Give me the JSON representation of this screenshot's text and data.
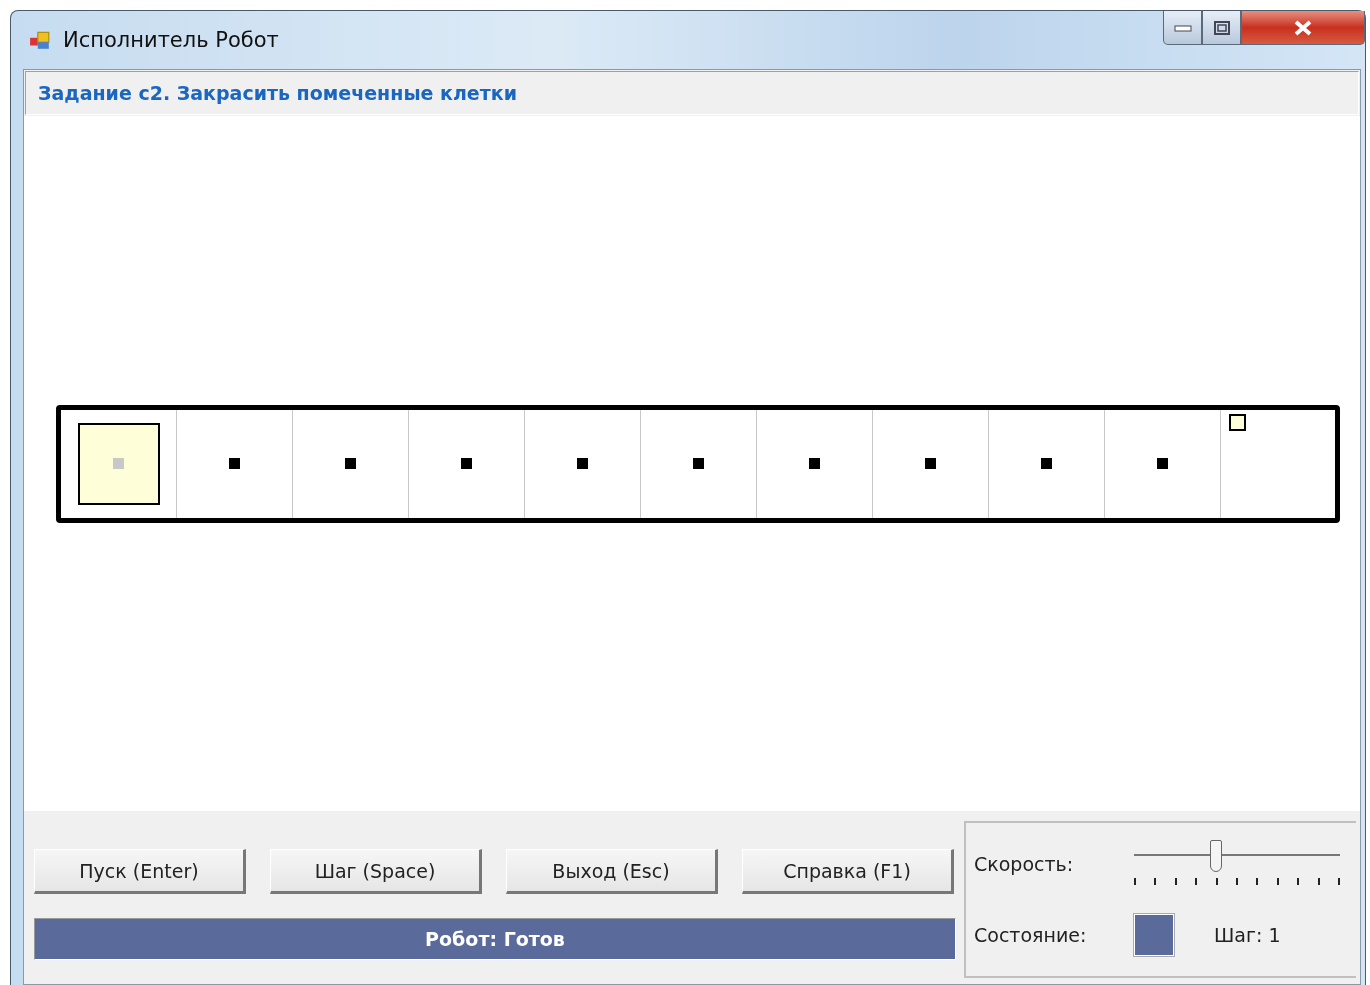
{
  "window": {
    "title": "Исполнитель Робот"
  },
  "task": {
    "title": "Задание c2. Закрасить помеченные клетки"
  },
  "field": {
    "cells": [
      {
        "kind": "robot"
      },
      {
        "kind": "marked"
      },
      {
        "kind": "marked"
      },
      {
        "kind": "marked"
      },
      {
        "kind": "marked"
      },
      {
        "kind": "marked"
      },
      {
        "kind": "marked"
      },
      {
        "kind": "marked"
      },
      {
        "kind": "marked"
      },
      {
        "kind": "marked"
      },
      {
        "kind": "finish"
      }
    ]
  },
  "buttons": [
    "Пуск (Enter)",
    "Шаг (Space)",
    "Выход (Esc)",
    "Справка (F1)"
  ],
  "status_bar": {
    "text": "Робот: Готов"
  },
  "speed": {
    "label": "Скорость:",
    "level": 0.4
  },
  "state": {
    "label": "Состояние:",
    "color": "#5a6a9a",
    "step": "Шаг: 1"
  }
}
